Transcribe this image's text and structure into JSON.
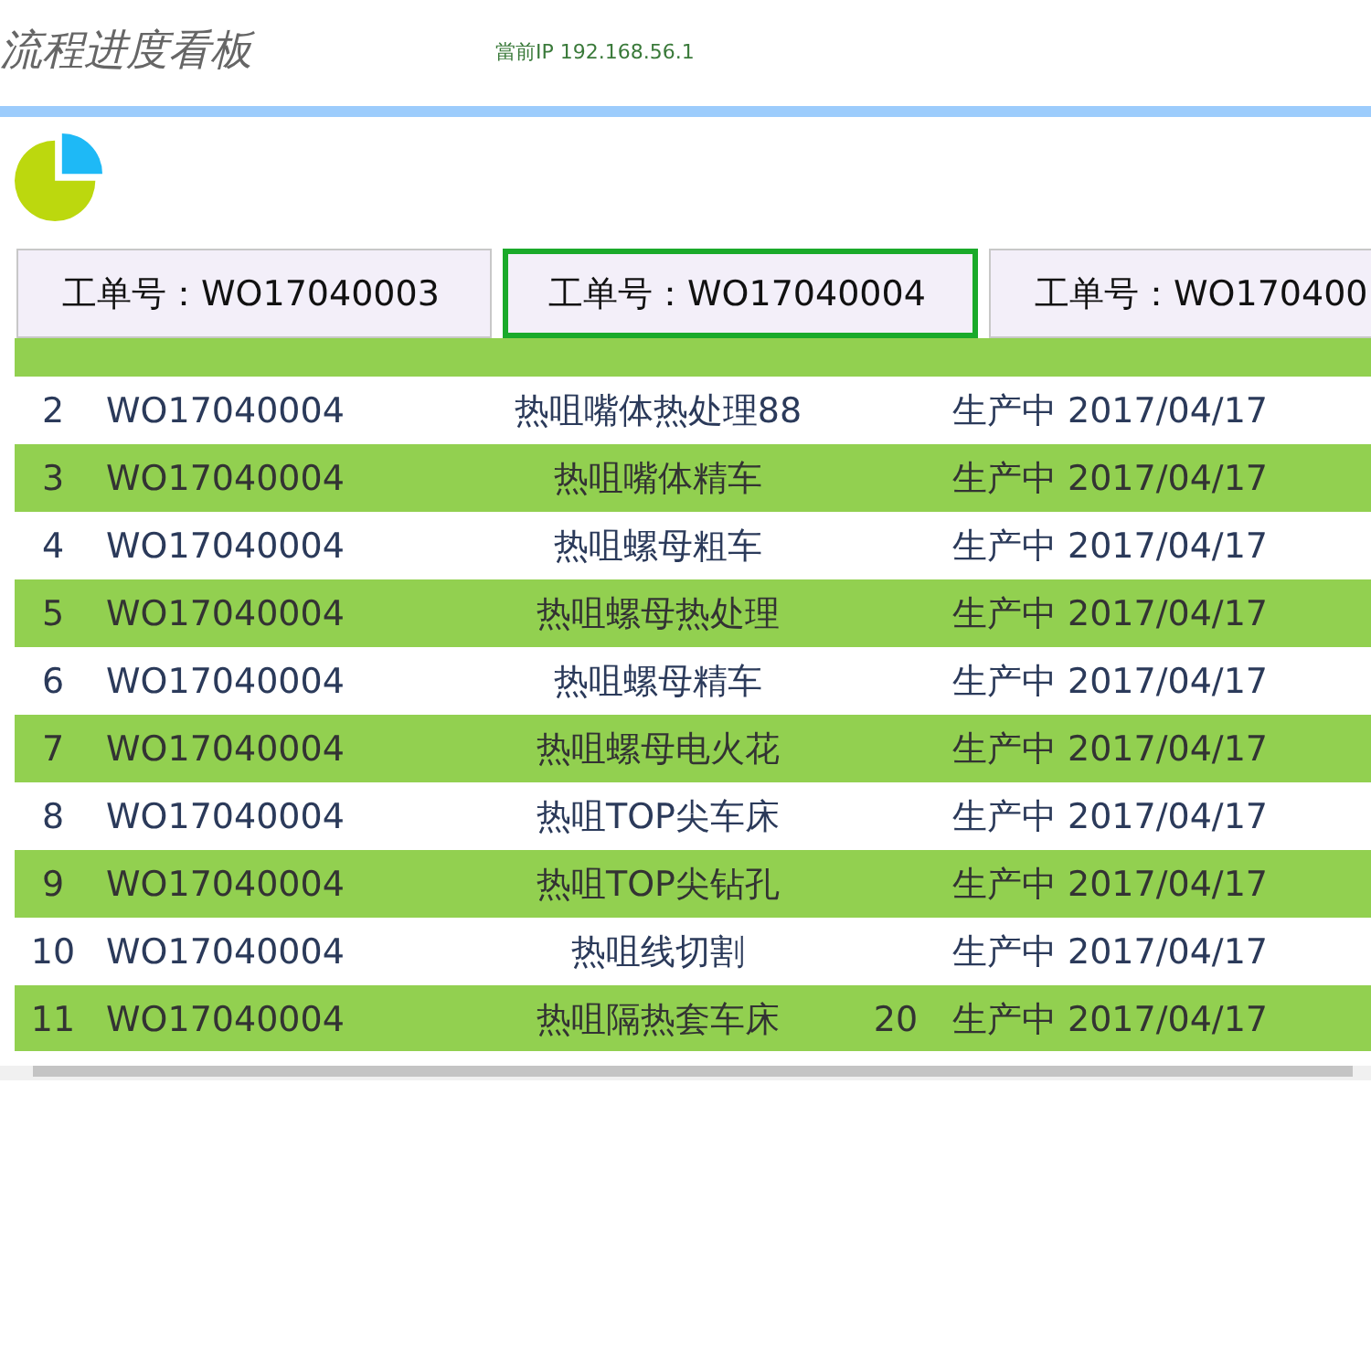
{
  "header": {
    "title": "流程进度看板",
    "ip": "當前IP 192.168.56.1"
  },
  "tabs": [
    {
      "label": "工单号：WO17040003",
      "selected": false
    },
    {
      "label": "工单号：WO17040004",
      "selected": true
    },
    {
      "label": "工单号：WO170400",
      "selected": false
    }
  ],
  "rows": [
    {
      "no": "2",
      "order": "WO17040004",
      "process": "热咀嘴体热处理88",
      "status": "生产中",
      "date": "2017/04/17"
    },
    {
      "no": "3",
      "order": "WO17040004",
      "process": "热咀嘴体精车",
      "status": "生产中",
      "date": "2017/04/17"
    },
    {
      "no": "4",
      "order": "WO17040004",
      "process": "热咀螺母粗车",
      "status": "生产中",
      "date": "2017/04/17"
    },
    {
      "no": "5",
      "order": "WO17040004",
      "process": "热咀螺母热处理",
      "status": "生产中",
      "date": "2017/04/17"
    },
    {
      "no": "6",
      "order": "WO17040004",
      "process": "热咀螺母精车",
      "status": "生产中",
      "date": "2017/04/17"
    },
    {
      "no": "7",
      "order": "WO17040004",
      "process": "热咀螺母电火花",
      "status": "生产中",
      "date": "2017/04/17"
    },
    {
      "no": "8",
      "order": "WO17040004",
      "process": "热咀TOP尖车床",
      "status": "生产中",
      "date": "2017/04/17"
    },
    {
      "no": "9",
      "order": "WO17040004",
      "process": "热咀TOP尖钻孔",
      "status": "生产中",
      "date": "2017/04/17"
    },
    {
      "no": "10",
      "order": "WO17040004",
      "process": "热咀线切割",
      "status": "生产中",
      "date": "2017/04/17"
    },
    {
      "no": "11",
      "order": "WO17040004",
      "process": "热咀隔热套车床",
      "qty": "20",
      "status": "生产中",
      "date": "2017/04/17"
    }
  ]
}
